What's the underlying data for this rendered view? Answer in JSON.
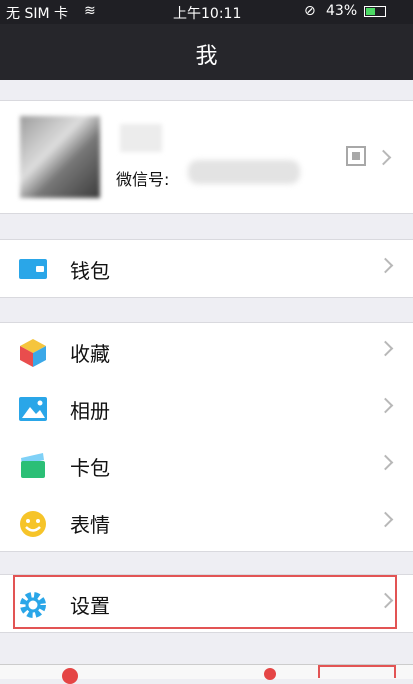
{
  "status": {
    "carrier": "无 SIM 卡",
    "time": "上午10:11",
    "battery": "43%"
  },
  "navbar": {
    "title": "我"
  },
  "profile": {
    "wechat_id_label": "微信号:"
  },
  "menu": {
    "wallet": "钱包",
    "favorites": "收藏",
    "album": "相册",
    "cards": "卡包",
    "stickers": "表情",
    "settings": "设置"
  },
  "colors": {
    "accent": "#2aa6e8",
    "highlight": "#e25454"
  }
}
